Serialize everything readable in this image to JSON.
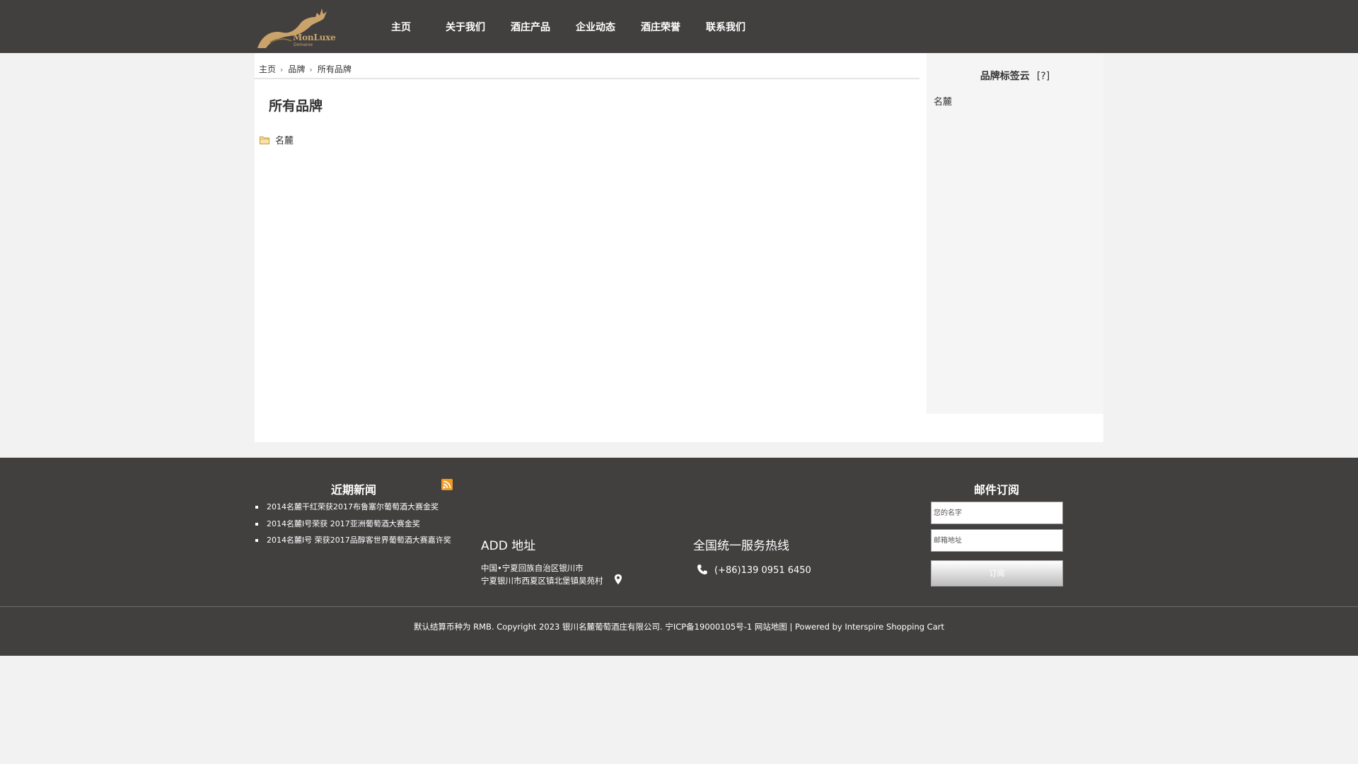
{
  "header": {
    "logo": {
      "name": "MonLuxe",
      "subtitle": "Domaine"
    },
    "nav": [
      "主页",
      "关于我们",
      "酒庄产品",
      "企业动态",
      "酒庄荣誉",
      "联系我们"
    ]
  },
  "breadcrumb": [
    "主页",
    "品牌",
    "所有品牌"
  ],
  "main": {
    "title": "所有品牌",
    "brands": [
      "名麓"
    ]
  },
  "sidebar": {
    "title": "品牌标签云",
    "help": "[?]",
    "tags": [
      "名麓"
    ]
  },
  "footer": {
    "news_title": "近期新闻",
    "news": [
      "2014名麓干红荣获2017布鲁塞尔葡萄酒大赛金奖",
      "2014名麓I号荣获 2017亚洲葡萄酒大赛金奖",
      "2014名麓I号 荣获2017品醇客世界葡萄酒大赛嘉许奖"
    ],
    "address_title": "ADD 地址",
    "address_line1": "中国•宁夏回族自治区银川市",
    "address_line2": "宁夏银川市西夏区镇北堡镇昊苑村",
    "hotline_title": "全国统一服务热线",
    "phone": "(+86)139 0951 6450",
    "subscribe_title": "邮件订阅",
    "name_placeholder": "您的名字",
    "email_placeholder": "邮箱地址",
    "subscribe_button": "订阅",
    "copyright_text": "默认结算币种为 RMB. Copyright 2023 银川名麓葡萄酒庄有限公司.   宁ICP备19000105号-1 ",
    "sitemap_link": "网站地图",
    "powered_sep": " | ",
    "powered_text": "Powered by Interspire Shopping Cart"
  },
  "colors": {
    "header_bg": "#423f3f",
    "footer_bg": "#423f3f",
    "page_bg": "#f2f2f2",
    "logo_gold": "#c9a36a"
  }
}
